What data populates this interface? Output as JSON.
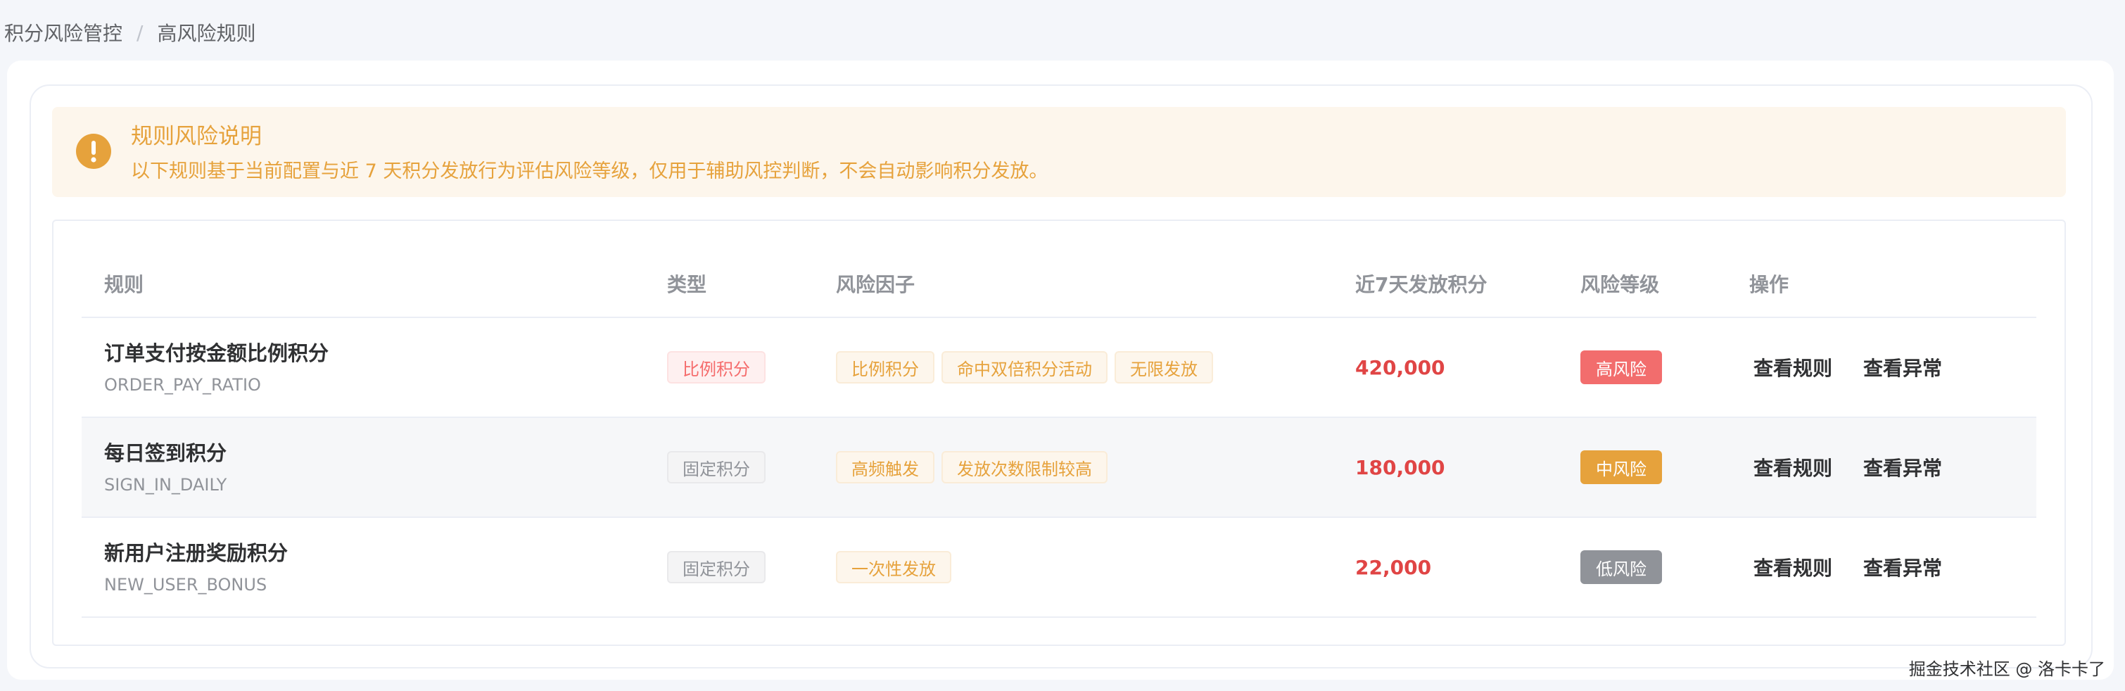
{
  "breadcrumb": {
    "parent": "积分风险管控",
    "separator": "/",
    "current": "高风险规则"
  },
  "alert": {
    "icon": "exclamation-icon",
    "title": "规则风险说明",
    "description": "以下规则基于当前配置与近 7 天积分发放行为评估风险等级，仅用于辅助风控判断，不会自动影响积分发放。",
    "color": "#e6a23c"
  },
  "table": {
    "headers": {
      "rule": "规则",
      "type": "类型",
      "factors": "风险因子",
      "issued": "近7天发放积分",
      "level": "风险等级",
      "actions": "操作"
    },
    "rows": [
      {
        "name": "订单支付按金额比例积分",
        "code": "ORDER_PAY_RATIO",
        "type": "比例积分",
        "type_style": "danger",
        "factors": [
          "比例积分",
          "命中双倍积分活动",
          "无限发放"
        ],
        "issued": "420,000",
        "level": "高风险",
        "level_color": "#f26d6d",
        "actions": [
          "查看规则",
          "查看异常"
        ]
      },
      {
        "name": "每日签到积分",
        "code": "SIGN_IN_DAILY",
        "type": "固定积分",
        "type_style": "info",
        "factors": [
          "高频触发",
          "发放次数限制较高"
        ],
        "issued": "180,000",
        "level": "中风险",
        "level_color": "#e6a23c",
        "actions": [
          "查看规则",
          "查看异常"
        ]
      },
      {
        "name": "新用户注册奖励积分",
        "code": "NEW_USER_BONUS",
        "type": "固定积分",
        "type_style": "info",
        "factors": [
          "一次性发放"
        ],
        "issued": "22,000",
        "level": "低风险",
        "level_color": "#909399",
        "actions": [
          "查看规则",
          "查看异常"
        ]
      }
    ]
  },
  "watermark": "掘金技术社区 @ 洛卡卡了"
}
